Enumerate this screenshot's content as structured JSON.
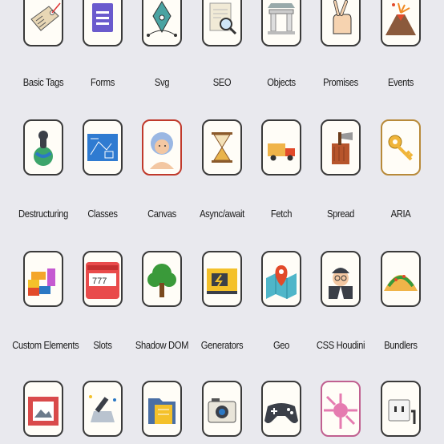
{
  "items": [
    {
      "label": "Basic Tags",
      "border": "#3a3a3a",
      "icon": "price-tag-icon"
    },
    {
      "label": "Forms",
      "border": "#3a3a3a",
      "icon": "form-document-icon"
    },
    {
      "label": "Svg",
      "border": "#3a3a3a",
      "icon": "pen-nib-icon"
    },
    {
      "label": "SEO",
      "border": "#3a3a3a",
      "icon": "search-document-icon"
    },
    {
      "label": "Objects",
      "border": "#3a3a3a",
      "icon": "columns-icon"
    },
    {
      "label": "Promises",
      "border": "#3a3a3a",
      "icon": "crossed-fingers-icon"
    },
    {
      "label": "Events",
      "border": "#3a3a3a",
      "icon": "volcano-icon"
    },
    {
      "label": "Destructuring",
      "border": "#3a3a3a",
      "icon": "explosion-globe-icon"
    },
    {
      "label": "Classes",
      "border": "#3a3a3a",
      "icon": "blueprint-icon"
    },
    {
      "label": "Canvas",
      "border": "#c0392b",
      "icon": "portrait-icon"
    },
    {
      "label": "Async/await",
      "border": "#3a3a3a",
      "icon": "hourglass-icon"
    },
    {
      "label": "Fetch",
      "border": "#3a3a3a",
      "icon": "delivery-truck-icon"
    },
    {
      "label": "Spread",
      "border": "#3a3a3a",
      "icon": "axe-stump-icon"
    },
    {
      "label": "ARIA",
      "border": "#b88a3a",
      "icon": "key-icon"
    },
    {
      "label": "Custom Elements",
      "border": "#3a3a3a",
      "icon": "lego-blocks-icon"
    },
    {
      "label": "Slots",
      "border": "#3a3a3a",
      "icon": "slot-machine-icon"
    },
    {
      "label": "Shadow DOM",
      "border": "#3a3a3a",
      "icon": "tree-icon"
    },
    {
      "label": "Generators",
      "border": "#3a3a3a",
      "icon": "generator-icon"
    },
    {
      "label": "Geo",
      "border": "#3a3a3a",
      "icon": "map-pin-icon"
    },
    {
      "label": "CSS Houdini",
      "border": "#3a3a3a",
      "icon": "magician-icon"
    },
    {
      "label": "Bundlers",
      "border": "#3a3a3a",
      "icon": "taco-icon"
    },
    {
      "label": "",
      "border": "#3a3a3a",
      "icon": "picture-frame-icon"
    },
    {
      "label": "",
      "border": "#3a3a3a",
      "icon": "telescope-icon"
    },
    {
      "label": "",
      "border": "#3a3a3a",
      "icon": "folder-icon"
    },
    {
      "label": "",
      "border": "#3a3a3a",
      "icon": "camera-icon"
    },
    {
      "label": "",
      "border": "#3a3a3a",
      "icon": "gamepad-icon"
    },
    {
      "label": "",
      "border": "#c06090",
      "icon": "expand-arrows-icon"
    },
    {
      "label": "",
      "border": "#3a3a3a",
      "icon": "power-outlet-icon"
    }
  ]
}
